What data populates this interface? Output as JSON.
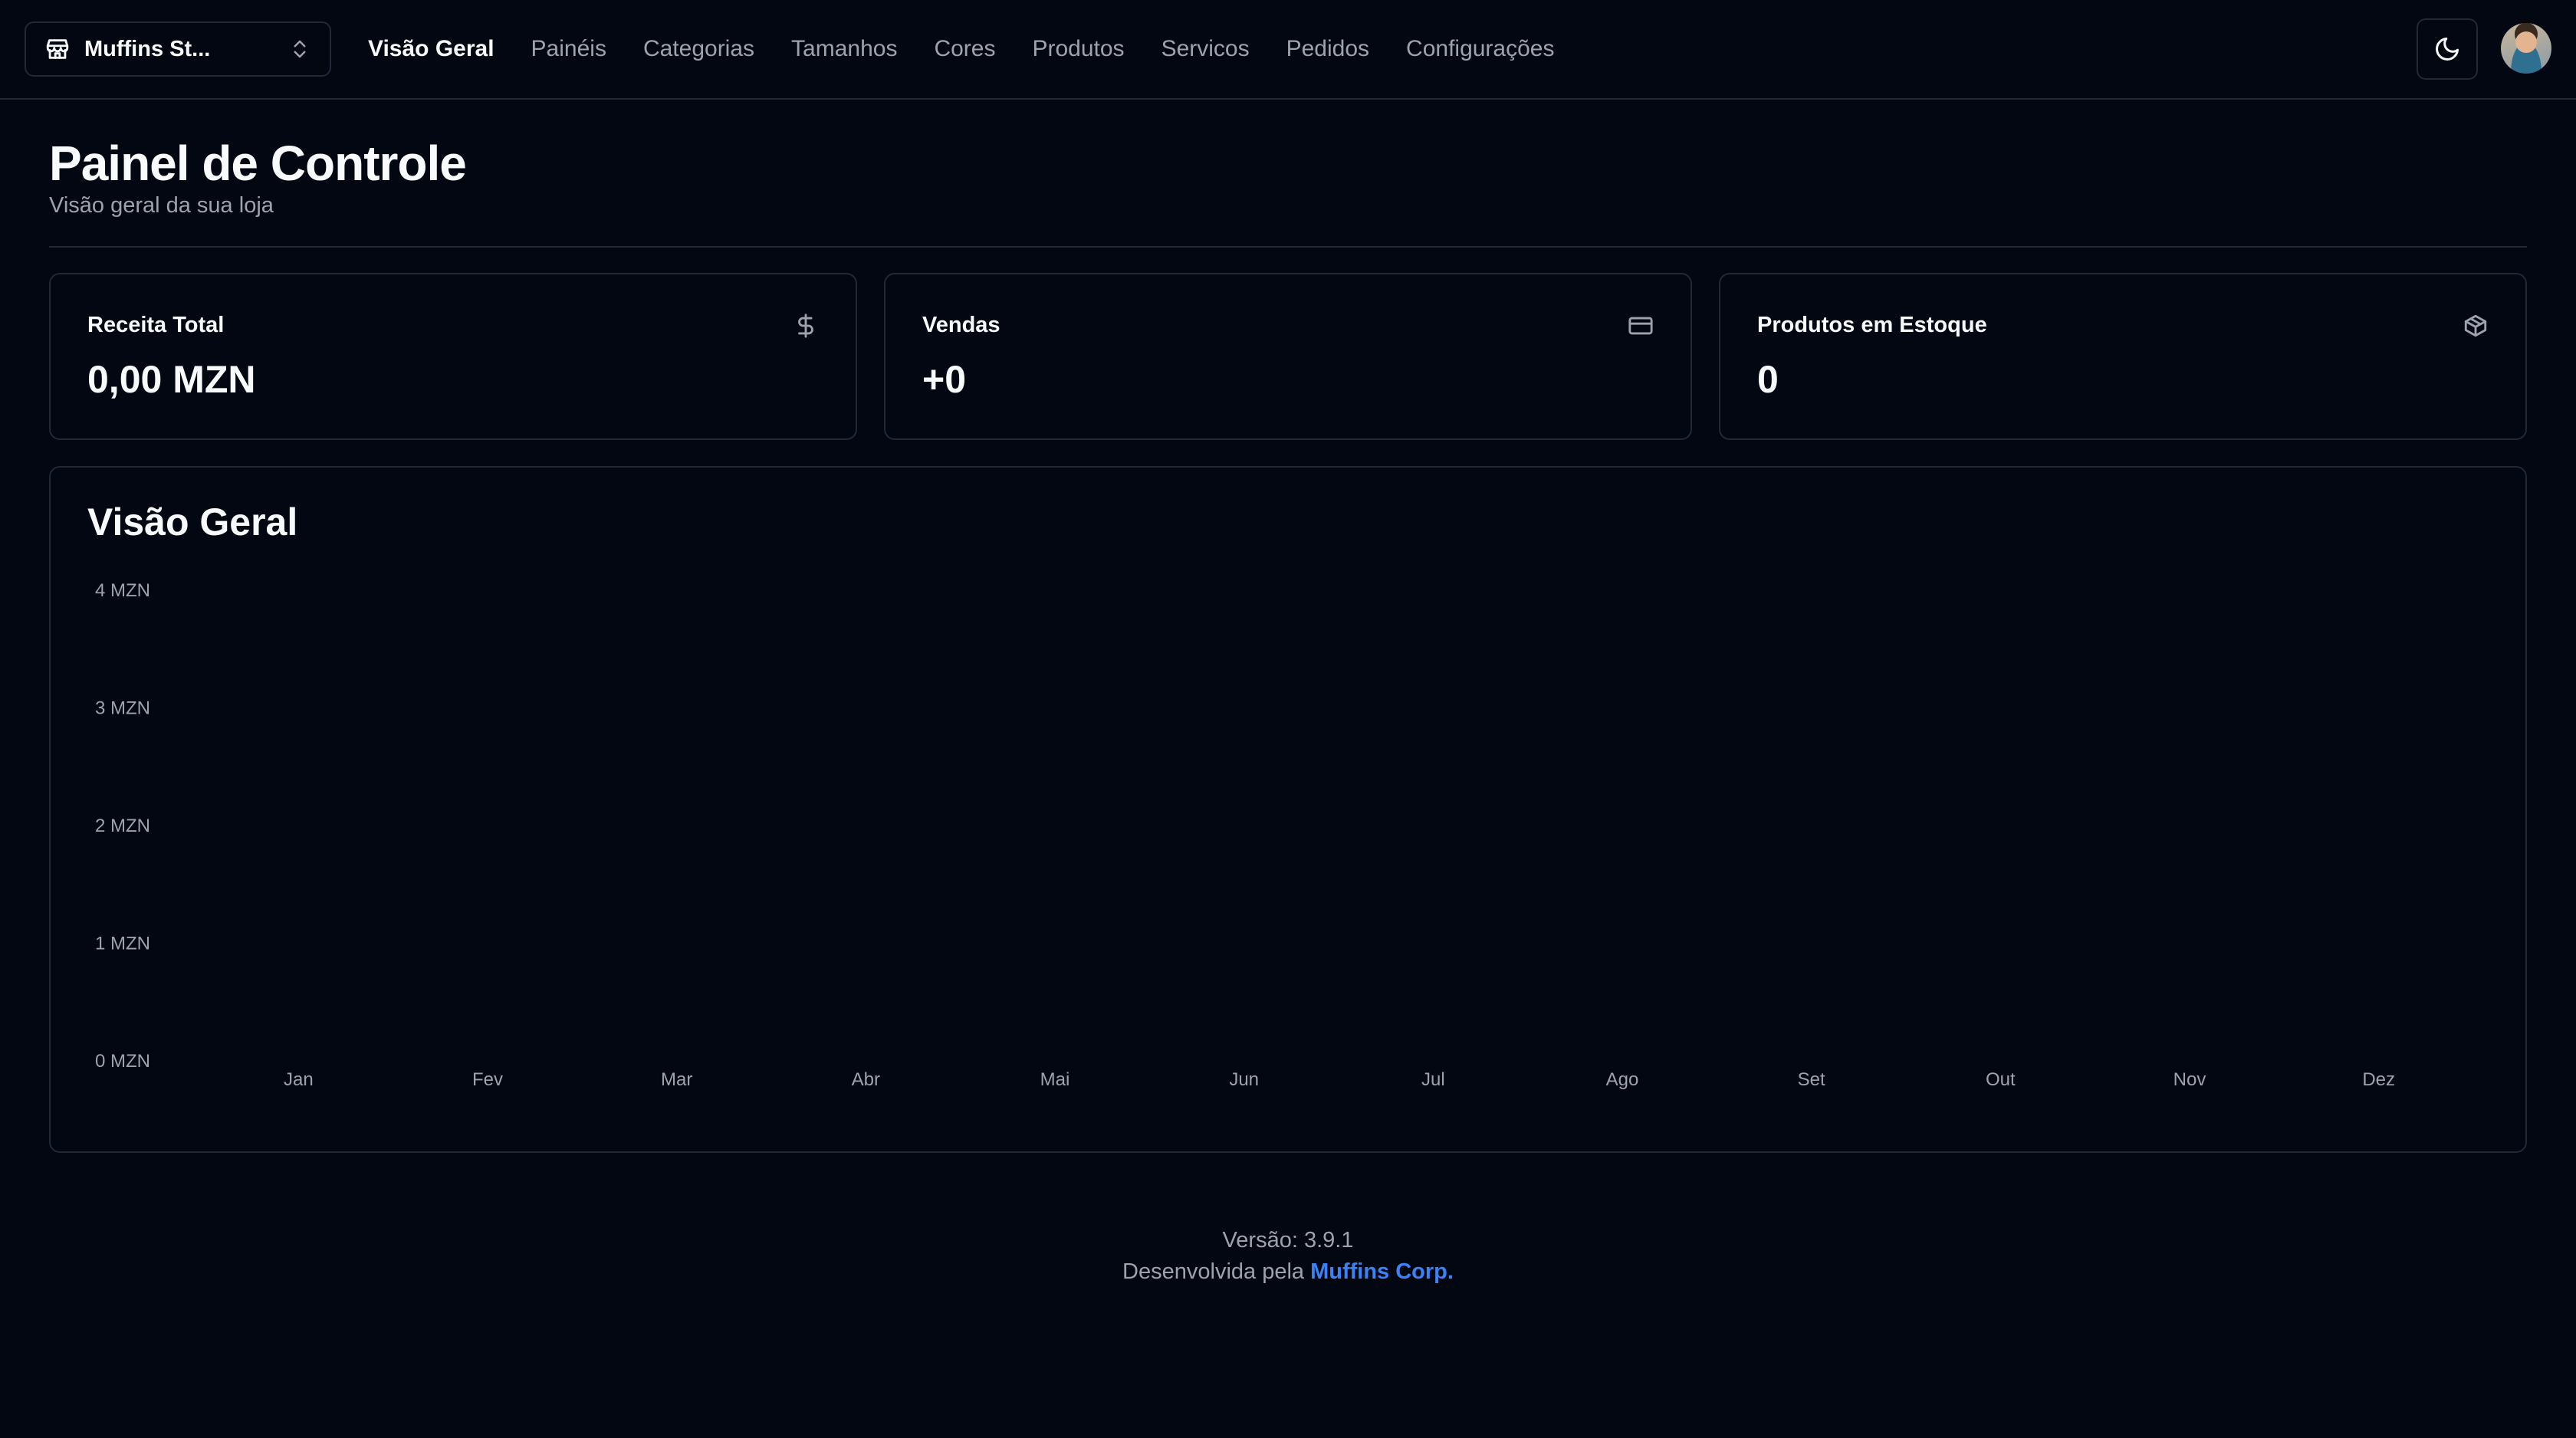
{
  "header": {
    "store_switcher": {
      "label": "Muffins St...",
      "icon": "store-icon",
      "toggle_icon": "chevrons-up-down-icon"
    },
    "nav": [
      {
        "label": "Visão Geral",
        "active": true
      },
      {
        "label": "Painéis",
        "active": false
      },
      {
        "label": "Categorias",
        "active": false
      },
      {
        "label": "Tamanhos",
        "active": false
      },
      {
        "label": "Cores",
        "active": false
      },
      {
        "label": "Produtos",
        "active": false
      },
      {
        "label": "Servicos",
        "active": false
      },
      {
        "label": "Pedidos",
        "active": false
      },
      {
        "label": "Configurações",
        "active": false
      }
    ],
    "theme_toggle_icon": "moon-icon"
  },
  "page": {
    "title": "Painel de Controle",
    "subtitle": "Visão geral da sua loja"
  },
  "cards": [
    {
      "label": "Receita Total",
      "value": "0,00 MZN",
      "icon": "dollar-icon"
    },
    {
      "label": "Vendas",
      "value": "+0",
      "icon": "credit-card-icon"
    },
    {
      "label": "Produtos em Estoque",
      "value": "0",
      "icon": "package-icon"
    }
  ],
  "overview": {
    "title": "Visão Geral"
  },
  "chart_data": {
    "type": "bar",
    "categories": [
      "Jan",
      "Fev",
      "Mar",
      "Abr",
      "Mai",
      "Jun",
      "Jul",
      "Ago",
      "Set",
      "Out",
      "Nov",
      "Dez"
    ],
    "values": [
      0,
      0,
      0,
      0,
      0,
      0,
      0,
      0,
      0,
      0,
      0,
      0
    ],
    "y_ticks": [
      "0 MZN",
      "1 MZN",
      "2 MZN",
      "3 MZN",
      "4 MZN"
    ],
    "ylim": [
      0,
      4
    ],
    "grid": false,
    "colors": {
      "bar": "#3b82f6",
      "tick_text": "#9ca3af"
    }
  },
  "footer": {
    "version": "Versão: 3.9.1",
    "developed_by": "Desenvolvida pela",
    "company": "Muffins Corp."
  },
  "colors": {
    "background": "#030712",
    "border": "#1f2937",
    "text": "#f9fafb",
    "muted": "#9ca3af",
    "accent": "#3b82f6"
  }
}
